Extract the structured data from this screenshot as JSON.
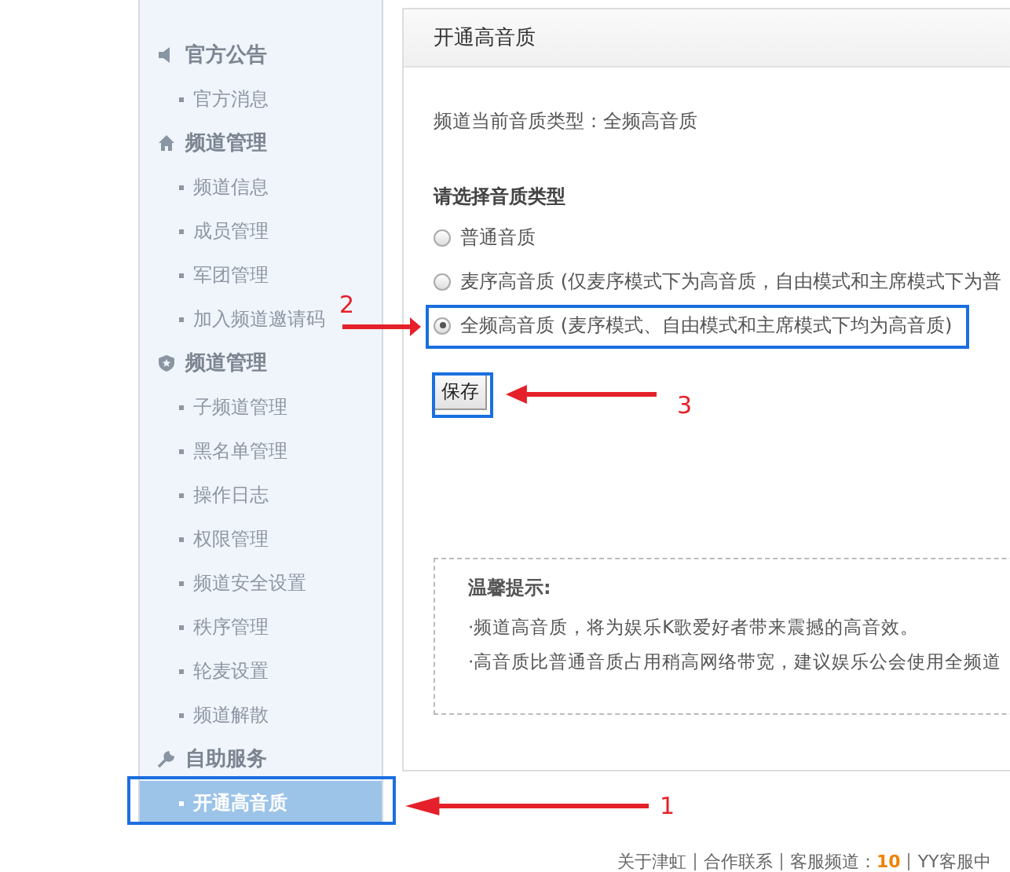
{
  "sidebar": {
    "groups": [
      {
        "title": "官方公告",
        "items": [
          {
            "label": "官方消息",
            "selected": false
          }
        ]
      },
      {
        "title": "频道管理",
        "items": [
          {
            "label": "频道信息",
            "selected": false
          },
          {
            "label": "成员管理",
            "selected": false
          },
          {
            "label": "军团管理",
            "selected": false
          },
          {
            "label": "加入频道邀请码",
            "selected": false
          }
        ]
      },
      {
        "title": "频道管理",
        "items": [
          {
            "label": "子频道管理",
            "selected": false
          },
          {
            "label": "黑名单管理",
            "selected": false
          },
          {
            "label": "操作日志",
            "selected": false
          },
          {
            "label": "权限管理",
            "selected": false
          },
          {
            "label": "频道安全设置",
            "selected": false
          },
          {
            "label": "秩序管理",
            "selected": false
          },
          {
            "label": "轮麦设置",
            "selected": false
          },
          {
            "label": "频道解散",
            "selected": false
          }
        ]
      },
      {
        "title": "自助服务",
        "items": [
          {
            "label": "开通高音质",
            "selected": true
          }
        ]
      }
    ]
  },
  "panel": {
    "title": "开通高音质",
    "current": "频道当前音质类型：全频高音质",
    "choose_label": "请选择音质类型",
    "options": [
      {
        "label": "普通音质",
        "selected": false
      },
      {
        "label": "麦序高音质 (仅麦序模式下为高音质，自由模式和主席模式下为普",
        "selected": false
      },
      {
        "label": "全频高音质 (麦序模式、自由模式和主席模式下均为高音质)",
        "selected": true
      }
    ],
    "save": "保存",
    "tips": {
      "title": "温馨提示:",
      "lines": [
        "·频道高音质，将为娱乐K歌爱好者带来震撼的高音效。",
        "·高音质比普通音质占用稍高网络带宽，建议娱乐公会使用全频道"
      ]
    }
  },
  "footer": {
    "links": [
      "关于津虹",
      "合作联系",
      "客服频道："
    ],
    "number": "10",
    "rest": "YY客服中"
  },
  "annotations": [
    {
      "number": "1"
    },
    {
      "number": "2"
    },
    {
      "number": "3"
    }
  ]
}
